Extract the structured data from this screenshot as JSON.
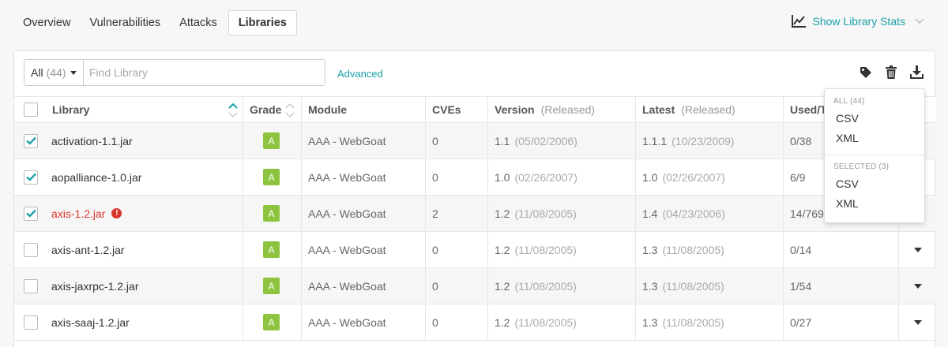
{
  "tabs": [
    {
      "label": "Overview",
      "active": false
    },
    {
      "label": "Vulnerabilities",
      "active": false
    },
    {
      "label": "Attacks",
      "active": false
    },
    {
      "label": "Libraries",
      "active": true
    }
  ],
  "stats_link": "Show Library Stats",
  "filter": {
    "selected": "All",
    "count": "(44)",
    "search_placeholder": "Find Library",
    "advanced_label": "Advanced"
  },
  "toolbar_icons": [
    "tag-icon",
    "trash-icon",
    "download-icon"
  ],
  "table": {
    "headers": {
      "library": "Library",
      "grade": "Grade",
      "module": "Module",
      "cves": "CVEs",
      "version": "Version",
      "version_sub": "(Released)",
      "latest": "Latest",
      "latest_sub": "(Released)",
      "used": "Used/To"
    },
    "rows": [
      {
        "checked": true,
        "name": "activation-1.1.jar",
        "vulnerable": false,
        "grade": "A",
        "module": "AAA - WebGoat",
        "cves": "0",
        "version": "1.1",
        "version_date": "(05/02/2006)",
        "latest": "1.1.1",
        "latest_date": "(10/23/2009)",
        "used": "0/38",
        "has_action": false
      },
      {
        "checked": true,
        "name": "aopalliance-1.0.jar",
        "vulnerable": false,
        "grade": "A",
        "module": "AAA - WebGoat",
        "cves": "0",
        "version": "1.0",
        "version_date": "(02/26/2007)",
        "latest": "1.0",
        "latest_date": "(02/26/2007)",
        "used": "6/9",
        "has_action": false
      },
      {
        "checked": true,
        "name": "axis-1.2.jar",
        "vulnerable": true,
        "grade": "A",
        "module": "AAA - WebGoat",
        "cves": "2",
        "version": "1.2",
        "version_date": "(11/08/2005)",
        "latest": "1.4",
        "latest_date": "(04/23/2006)",
        "used": "14/769",
        "has_action": false
      },
      {
        "checked": false,
        "name": "axis-ant-1.2.jar",
        "vulnerable": false,
        "grade": "A",
        "module": "AAA - WebGoat",
        "cves": "0",
        "version": "1.2",
        "version_date": "(11/08/2005)",
        "latest": "1.3",
        "latest_date": "(11/08/2005)",
        "used": "0/14",
        "has_action": true
      },
      {
        "checked": false,
        "name": "axis-jaxrpc-1.2.jar",
        "vulnerable": false,
        "grade": "A",
        "module": "AAA - WebGoat",
        "cves": "0",
        "version": "1.2",
        "version_date": "(11/08/2005)",
        "latest": "1.3",
        "latest_date": "(11/08/2005)",
        "used": "1/54",
        "has_action": true
      },
      {
        "checked": false,
        "name": "axis-saaj-1.2.jar",
        "vulnerable": false,
        "grade": "A",
        "module": "AAA - WebGoat",
        "cves": "0",
        "version": "1.2",
        "version_date": "(11/08/2005)",
        "latest": "1.3",
        "latest_date": "(11/08/2005)",
        "used": "0/27",
        "has_action": true
      }
    ]
  },
  "export_menu": {
    "all_header": "ALL (44)",
    "all_items": [
      "CSV",
      "XML"
    ],
    "selected_header": "SELECTED (3)",
    "selected_items": [
      "CSV",
      "XML"
    ]
  },
  "colors": {
    "accent": "#1aa0a8",
    "grade_a": "#8cc43f",
    "vulnerable": "#d9342b"
  }
}
